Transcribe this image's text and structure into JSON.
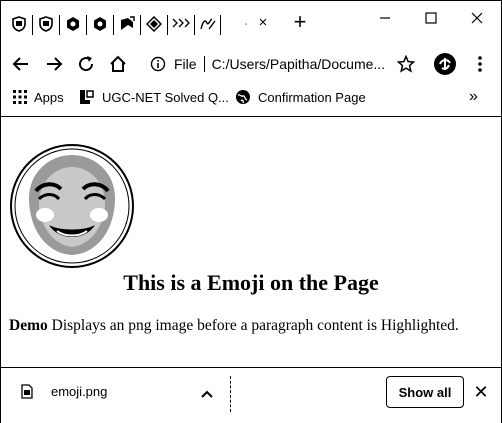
{
  "tabs": {
    "icons": [
      "shield-icon",
      "shield-icon",
      "hexagon-icon",
      "hexagon-icon",
      "bookmark-flag-icon",
      "diamond-icon",
      "grid-pattern-icon",
      "script-icon",
      "gmail-icon",
      "google-icon"
    ],
    "close_symbol": "×",
    "newtab_symbol": "+"
  },
  "window_controls": {
    "minimize": "minimize-icon",
    "maximize": "maximize-icon",
    "close": "close-icon"
  },
  "toolbar": {
    "scheme": "File",
    "url": "C:/Users/Papitha/Docume..."
  },
  "bookmarks": {
    "items": [
      {
        "label": "Apps",
        "icon": "apps-grid-icon"
      },
      {
        "label": "UGC-NET Solved Q...",
        "icon": "bookmark-site-icon"
      },
      {
        "label": "Confirmation Page",
        "icon": "globe-icon"
      }
    ],
    "more": "»"
  },
  "page": {
    "heading": "This is a Emoji on the Page",
    "paragraph_bold": "Demo",
    "paragraph_rest": " Displays an png image before a paragraph content is Highlighted."
  },
  "downloads": {
    "file_name": "emoji.png",
    "show_all": "Show all",
    "close_symbol": "✕"
  }
}
